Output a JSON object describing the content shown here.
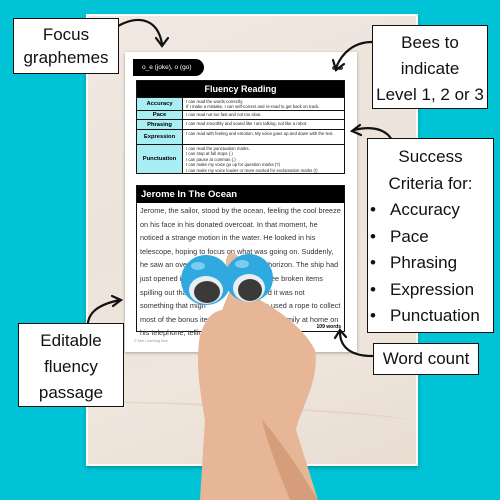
{
  "worksheet": {
    "focus_graphemes": "o_e (joke), o (go)",
    "table_title": "Fluency Reading",
    "criteria": [
      {
        "name": "Accuracy",
        "lines": [
          "I can read the words correctly.",
          "If I make a mistake, I can self-correct and re-read to get back on track."
        ]
      },
      {
        "name": "Pace",
        "lines": [
          "I can read not too fast and not too slow."
        ]
      },
      {
        "name": "Phrasing",
        "lines": [
          "I can read smoothly and sound like I am talking, not like a robot."
        ]
      },
      {
        "name": "Expression",
        "lines": [
          "I can read with feeling and emotion. My voice goes up and down with the text."
        ]
      },
      {
        "name": "Punctuation",
        "lines": [
          "I can read the punctuation marks.",
          "I can stop at full stops (.)",
          "I can pause at commas (,)",
          "I can make my voice go up for question marks (?)",
          "I can make my voice louder or more excited for exclamation marks (!)"
        ]
      }
    ],
    "passage_title": "Jerome In The Ocean",
    "passage_lines": [
      "Jerome, the sailor, stood by the ocean, feeling the cool breeze",
      "on his face in his donated overcoat. In that moment, he",
      "noticed a strange motion in the water. He looked in his",
      "telescope, hoping to focus on what was going on. Suddenly,",
      "he saw an overlo                              the horizon. The ship had",
      "just opened its                              could see broken items",
      "spilling out that                            e hoped it was not",
      "something that migh                       rome used a rope to collect",
      "most of the bonus items           spoke to his family at home on",
      "his telephone, telling th                        adventure."
    ],
    "word_count": "109 words",
    "copyright": "© Mrs Learning Bee"
  },
  "callouts": {
    "focus": "Focus graphemes",
    "focus_lines": [
      "Focus",
      "graphemes"
    ],
    "bees_lines": [
      "Bees to",
      "indicate",
      "Level 1, 2 or 3"
    ],
    "success_lines": [
      "Success",
      "Criteria for:"
    ],
    "success_items": [
      "Accuracy",
      "Pace",
      "Phrasing",
      "Expression",
      "Punctuation"
    ],
    "bullet": "•",
    "editable_lines": [
      "Editable",
      "fluency",
      "passage"
    ],
    "word_count": "Word count"
  },
  "colors": {
    "background": "#00c4d6",
    "criteria_cell": "#a8eef2",
    "googly_eye_blue": "#2fa9e0"
  }
}
